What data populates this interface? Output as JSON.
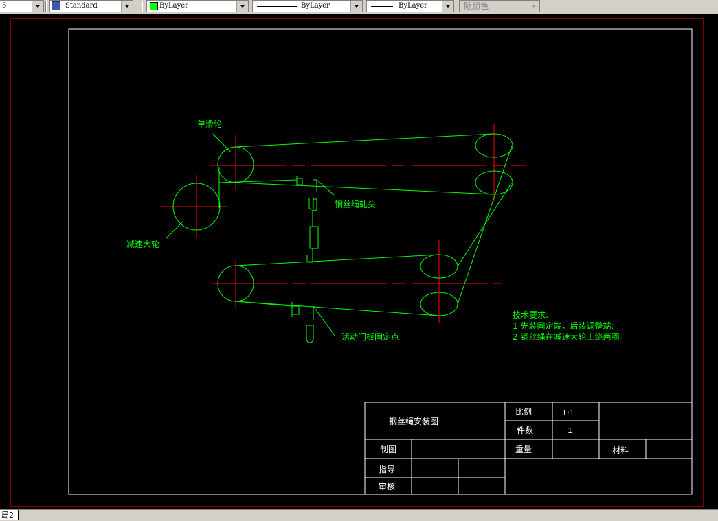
{
  "toolbar": {
    "layer_value": "5",
    "text_style": "Standard",
    "color_value": "ByLayer",
    "linetype_value": "ByLayer",
    "lineweight_value": "ByLayer",
    "plot_style": "随颜色"
  },
  "drawing": {
    "labels": {
      "single_pulley": "单滑轮",
      "rope_clamp": "钢丝绳轧头",
      "reducer_wheel": "减速大轮",
      "door_fixed_point": "活动门板固定点"
    },
    "tech": {
      "title": "技术要求:",
      "line1": "1 先装固定端，后装调整端;",
      "line2": "2 钢丝绳在减速大轮上绕两圈。"
    },
    "title_block": {
      "drawing_name": "钢丝绳安装图",
      "scale_label": "比例",
      "scale_value": "1:1",
      "count_label": "件数",
      "count_value": "1",
      "weight_label": "重量",
      "material_label": "材料",
      "drawn_label": "制图",
      "guide_label": "指导",
      "review_label": "审核"
    }
  },
  "colors": {
    "geometry": "#00ff00",
    "centerline": "#ff0000",
    "border": "#ffffff",
    "layout_frame": "#ff0000",
    "background": "#000000"
  },
  "status": {
    "layout_tab": "局2"
  }
}
